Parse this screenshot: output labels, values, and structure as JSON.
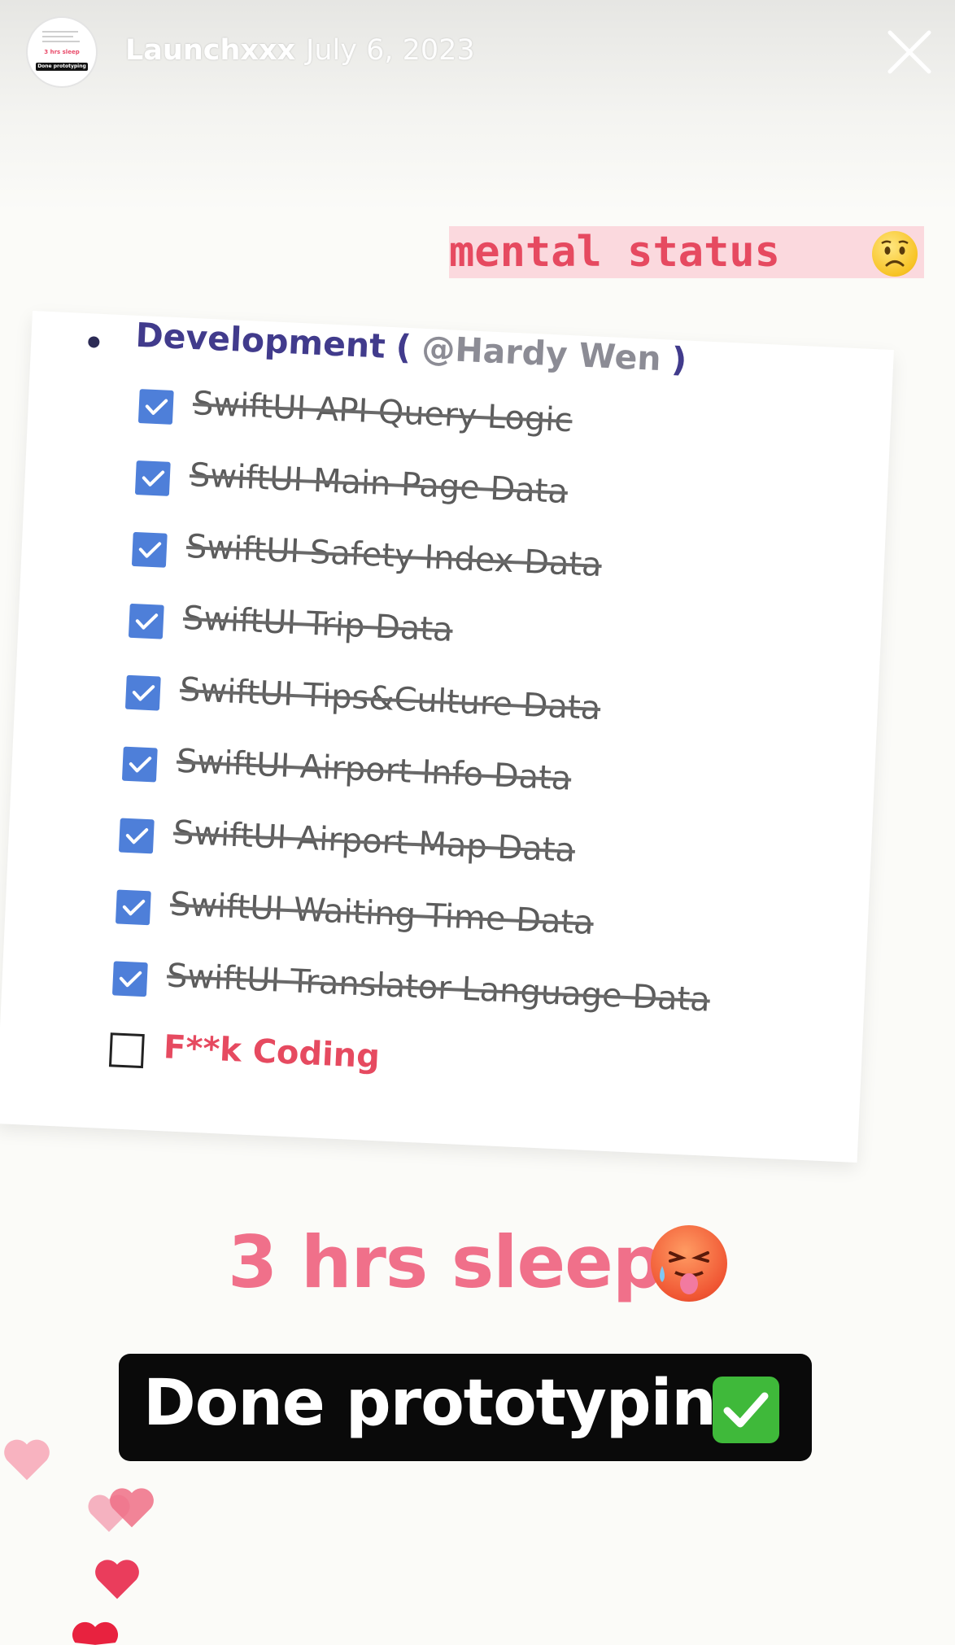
{
  "header": {
    "username": "Launchxxx",
    "date": "July 6, 2023",
    "avatar": {
      "sleep_text": "3 hrs sleep",
      "done_text": "Done prototyping"
    }
  },
  "sticker": {
    "mental_status": "mental status",
    "emoji": "worried-face-emoji"
  },
  "checklist": {
    "heading": "Development",
    "paren_open": "(",
    "mention": "@Hardy Wen",
    "paren_close": ")",
    "items": [
      {
        "label": "SwiftUI API Query Logic",
        "checked": true
      },
      {
        "label": "SwiftUI Main Page Data",
        "checked": true
      },
      {
        "label": "SwiftUI Safety Index Data",
        "checked": true
      },
      {
        "label": "SwiftUI Trip Data",
        "checked": true
      },
      {
        "label": "SwiftUI Tips&Culture Data",
        "checked": true
      },
      {
        "label": "SwiftUI Airport Info Data",
        "checked": true
      },
      {
        "label": "SwiftUI Airport Map Data",
        "checked": true
      },
      {
        "label": "SwiftUI Waiting Time Data",
        "checked": true
      },
      {
        "label": "SwiftUI Translator Language Data",
        "checked": true
      },
      {
        "label": "F**k Coding",
        "checked": false
      }
    ]
  },
  "caption": {
    "sleep": "3 hrs sleep",
    "sleep_emoji": "hot-face-emoji",
    "done": "Done prototyping",
    "done_emoji": "check-mark-button-emoji"
  },
  "colors": {
    "accent_pink": "#f0708a",
    "strike_pink": "#e64a60",
    "checkbox_blue": "#4e7fd9",
    "heading_purple": "#413b8c"
  }
}
